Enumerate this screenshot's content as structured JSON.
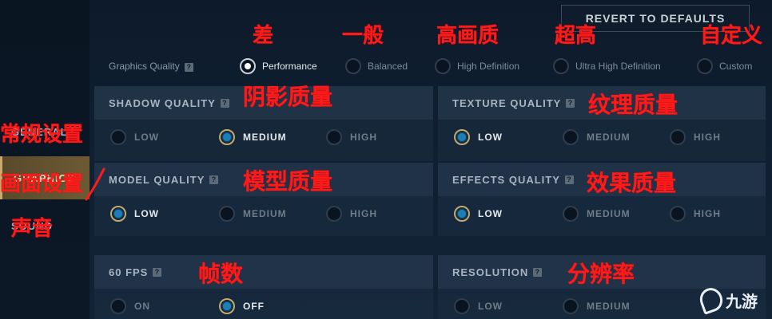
{
  "sidebar": {
    "items": [
      {
        "label": "GENERAL",
        "visible_label": "GENERAL"
      },
      {
        "label": "GRAPHICS",
        "visible_label": "GRAPHICS"
      },
      {
        "label": "SOUND",
        "visible_label": "SOUND"
      }
    ]
  },
  "header": {
    "revert_label": "REVERT TO DEFAULTS"
  },
  "graphics_quality": {
    "label": "Graphics Quality",
    "help": "?",
    "options": [
      {
        "label": "Performance",
        "selected": true
      },
      {
        "label": "Balanced",
        "selected": false
      },
      {
        "label": "High Definition",
        "selected": false
      },
      {
        "label": "Ultra High Definition",
        "selected": false
      },
      {
        "label": "Custom",
        "selected": false
      }
    ]
  },
  "panels": {
    "shadow": {
      "title": "SHADOW QUALITY",
      "help": "?",
      "options": [
        "LOW",
        "MEDIUM",
        "HIGH"
      ],
      "selected": "MEDIUM"
    },
    "texture": {
      "title": "TEXTURE QUALITY",
      "help": "?",
      "options": [
        "LOW",
        "MEDIUM",
        "HIGH"
      ],
      "selected": "LOW"
    },
    "model": {
      "title": "MODEL QUALITY",
      "help": "?",
      "options": [
        "LOW",
        "MEDIUM",
        "HIGH"
      ],
      "selected": "LOW"
    },
    "effects": {
      "title": "EFFECTS QUALITY",
      "help": "?",
      "options": [
        "LOW",
        "MEDIUM",
        "HIGH"
      ],
      "selected": "LOW"
    },
    "fps": {
      "title": "60 FPS",
      "help": "?",
      "options": [
        "ON",
        "OFF"
      ],
      "selected": "OFF"
    },
    "resolution": {
      "title": "RESOLUTION",
      "help": "?",
      "options": [
        "LOW",
        "MEDIUM"
      ],
      "selected": "LOW"
    }
  },
  "annotations": {
    "poor": "差",
    "normal": "一般",
    "hd": "高画质",
    "ultra": "超高",
    "custom": "自定义",
    "shadow": "阴影质量",
    "texture": "纹理质量",
    "general": "常规设置",
    "graphics": "画面设置",
    "model": "模型质量",
    "effects": "效果质量",
    "sound": "声音",
    "fps": "帧数",
    "resolution": "分辨率"
  },
  "watermark": {
    "text": "九游",
    "icon": "jiuyou-logo-icon"
  },
  "colors": {
    "accent_gold": "#c8aa6e",
    "selected_blue": "#1e7fb8",
    "annotation_red": "#ff1a1a"
  }
}
